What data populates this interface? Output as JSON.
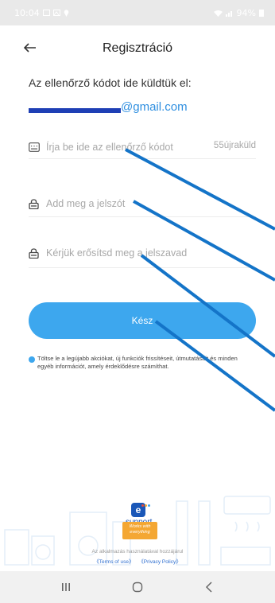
{
  "status_bar": {
    "time": "10:04",
    "battery": "94%"
  },
  "header": {
    "title": "Regisztráció",
    "back_icon": "arrow-left-icon"
  },
  "info": {
    "text": "Az ellenőrző kódot ide küldtük el:",
    "email_domain": "@gmail.com"
  },
  "form": {
    "code_placeholder": "Írja be ide az ellenőrző kódot",
    "resend_label": "55újraküld",
    "password_placeholder": "Add meg a jelszót",
    "confirm_placeholder": "Kérjük erősítsd meg a jelszavad",
    "submit_label": "Kész"
  },
  "consent": {
    "text": "Töltse le a legújabb akciókat, új funkciók frissítéseit, útmutatásait és minden egyéb információt, amely érdeklődésre számíthat."
  },
  "footer": {
    "logo_letter": "e",
    "logo_word": "support",
    "tagline": "Works with everything",
    "legal_text": "Az alkalmazás használatával hozzájárul",
    "terms_link": "《Terms of use》",
    "privacy_link": "《Privacy Policy》"
  },
  "nav": {
    "recent_icon": "recent-apps-icon",
    "home_icon": "home-icon",
    "back_icon": "back-icon"
  },
  "colors": {
    "accent": "#3da7ee",
    "email": "#2f8fe0",
    "annotation": "#1474c8"
  }
}
